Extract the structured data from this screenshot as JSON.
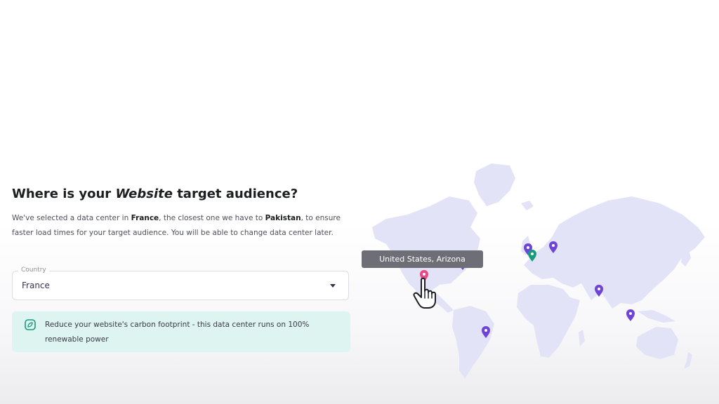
{
  "heading": {
    "prefix": "Where is your ",
    "emphasis": "Website",
    "suffix": " target audience?"
  },
  "description": {
    "part1": "We've selected a data center in ",
    "country": "France",
    "part2": ", the closest one we have to ",
    "origin": "Pakistan",
    "part3": ", to ensure faster load times for your target audience. You will be able to change data center later."
  },
  "country_field": {
    "label": "Country",
    "value": "France"
  },
  "notice": {
    "text": "Reduce your website's carbon footprint - this data center runs on 100% renewable power"
  },
  "map": {
    "tooltip": "United States, Arizona",
    "land_color": "#e2e3f7",
    "pin_color": "#6e43d8",
    "selected_pin_color": "#179b7c",
    "hover_pin_color": "#e74a85",
    "pins": [
      {
        "id": "north-america-east",
        "state": "default"
      },
      {
        "id": "europe-west-1",
        "state": "default"
      },
      {
        "id": "europe-east",
        "state": "default"
      },
      {
        "id": "france",
        "state": "selected"
      },
      {
        "id": "india",
        "state": "default"
      },
      {
        "id": "southeast-asia",
        "state": "default"
      },
      {
        "id": "south-america",
        "state": "default"
      },
      {
        "id": "us-arizona",
        "state": "hover"
      }
    ]
  },
  "colors": {
    "text_dark": "#1d1e20",
    "notice_bg": "#def4f0",
    "accent_green": "#179b7c"
  }
}
